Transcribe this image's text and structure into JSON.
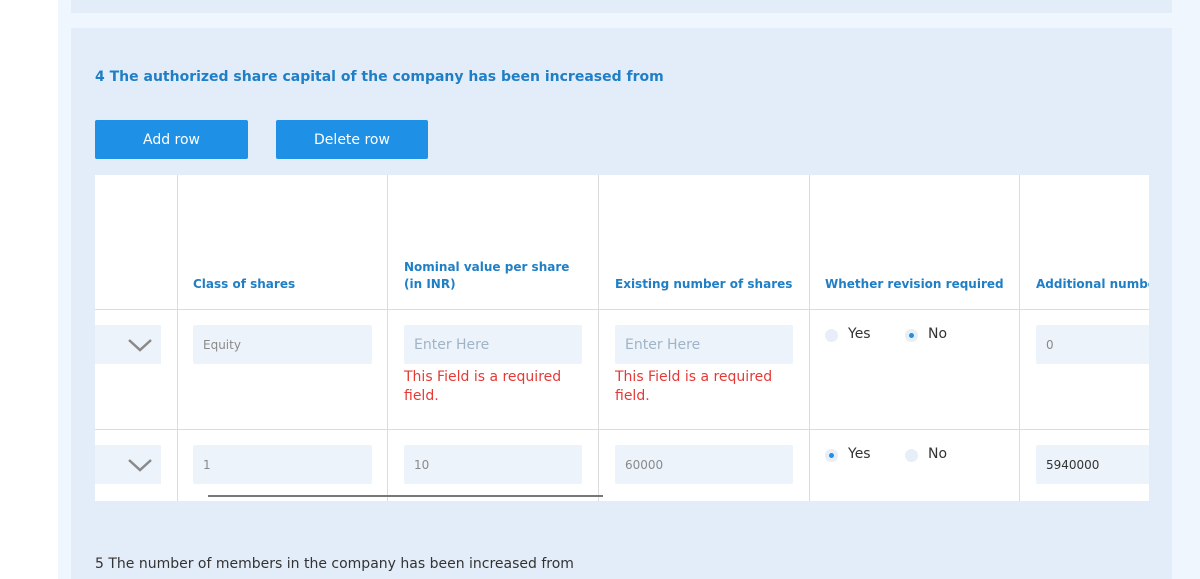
{
  "section4": {
    "title": "4 The authorized share capital of the company has been increased from",
    "add_row_label": "Add row",
    "delete_row_label": "Delete row",
    "columns": [
      "Class of shares",
      "Nominal value per share (in INR)",
      "Existing number of shares",
      "Whether revision required",
      "Additional number"
    ],
    "rows": [
      {
        "class_of_shares": "Equity",
        "nominal_value": "",
        "nominal_placeholder": "Enter Here",
        "nominal_error": "This Field is a required field.",
        "existing_shares": "",
        "existing_placeholder": "Enter Here",
        "existing_error": "This Field is a required field.",
        "revision_yes_label": "Yes",
        "revision_no_label": "No",
        "revision_selected": "No",
        "additional_number": "0"
      },
      {
        "class_of_shares": "1",
        "nominal_value": "10",
        "existing_shares": "60000",
        "revision_yes_label": "Yes",
        "revision_no_label": "No",
        "revision_selected": "Yes",
        "additional_number": "5940000"
      }
    ]
  },
  "section5": {
    "title": "5 The number of members in the company has been increased from"
  },
  "icons": {
    "dropdown": "chevron-down-icon"
  },
  "colors": {
    "accent": "#1e90e6",
    "heading": "#1f7fc6",
    "error": "#e53935",
    "panel": "#e3edf9"
  }
}
